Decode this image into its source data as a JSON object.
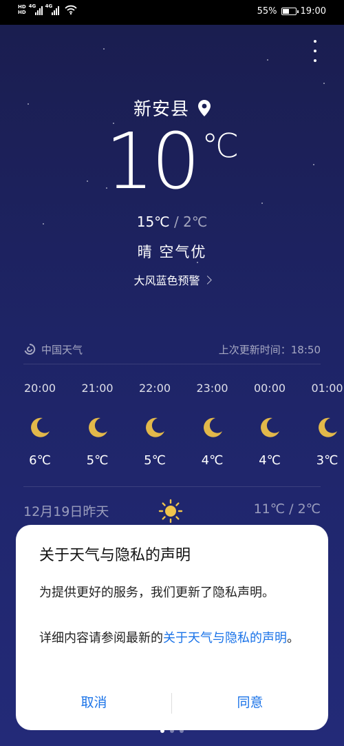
{
  "status_bar": {
    "hd1": "HD",
    "hd2": "HD",
    "net1": "4G",
    "net2": "4G",
    "battery_text": "55%",
    "battery_level": 0.55,
    "time": "19:00"
  },
  "header": {
    "city": "新安县",
    "more_icon": "more-vertical-icon",
    "location_icon": "location-pin-icon"
  },
  "current": {
    "temp": "10",
    "unit": "℃",
    "high": "15℃",
    "sep": " / ",
    "low": "2℃",
    "condition": "晴  空气优",
    "alert": "大风蓝色预警"
  },
  "source": {
    "name": "中国天气",
    "updated": "上次更新时间：18:50"
  },
  "hourly": [
    {
      "time": "20:00",
      "icon": "moon-icon",
      "temp": "6℃"
    },
    {
      "time": "21:00",
      "icon": "moon-icon",
      "temp": "5℃"
    },
    {
      "time": "22:00",
      "icon": "moon-icon",
      "temp": "5℃"
    },
    {
      "time": "23:00",
      "icon": "moon-icon",
      "temp": "4℃"
    },
    {
      "time": "00:00",
      "icon": "moon-icon",
      "temp": "4℃"
    },
    {
      "time": "01:00",
      "icon": "moon-icon",
      "temp": "3℃"
    }
  ],
  "daily": {
    "date": "12月19日昨天",
    "icon": "sun-icon",
    "range": "11℃ / 2℃"
  },
  "dialog": {
    "title": "关于天气与隐私的声明",
    "p1": "为提供更好的服务，我们更新了隐私声明。",
    "p2_prefix": "详细内容请参阅最新的",
    "p2_link": "关于天气与隐私的声明",
    "p2_suffix": "。",
    "cancel": "取消",
    "agree": "同意"
  },
  "colors": {
    "accent": "#1a73e8",
    "moon": "#e2b84a",
    "sun": "#f0c44c"
  }
}
